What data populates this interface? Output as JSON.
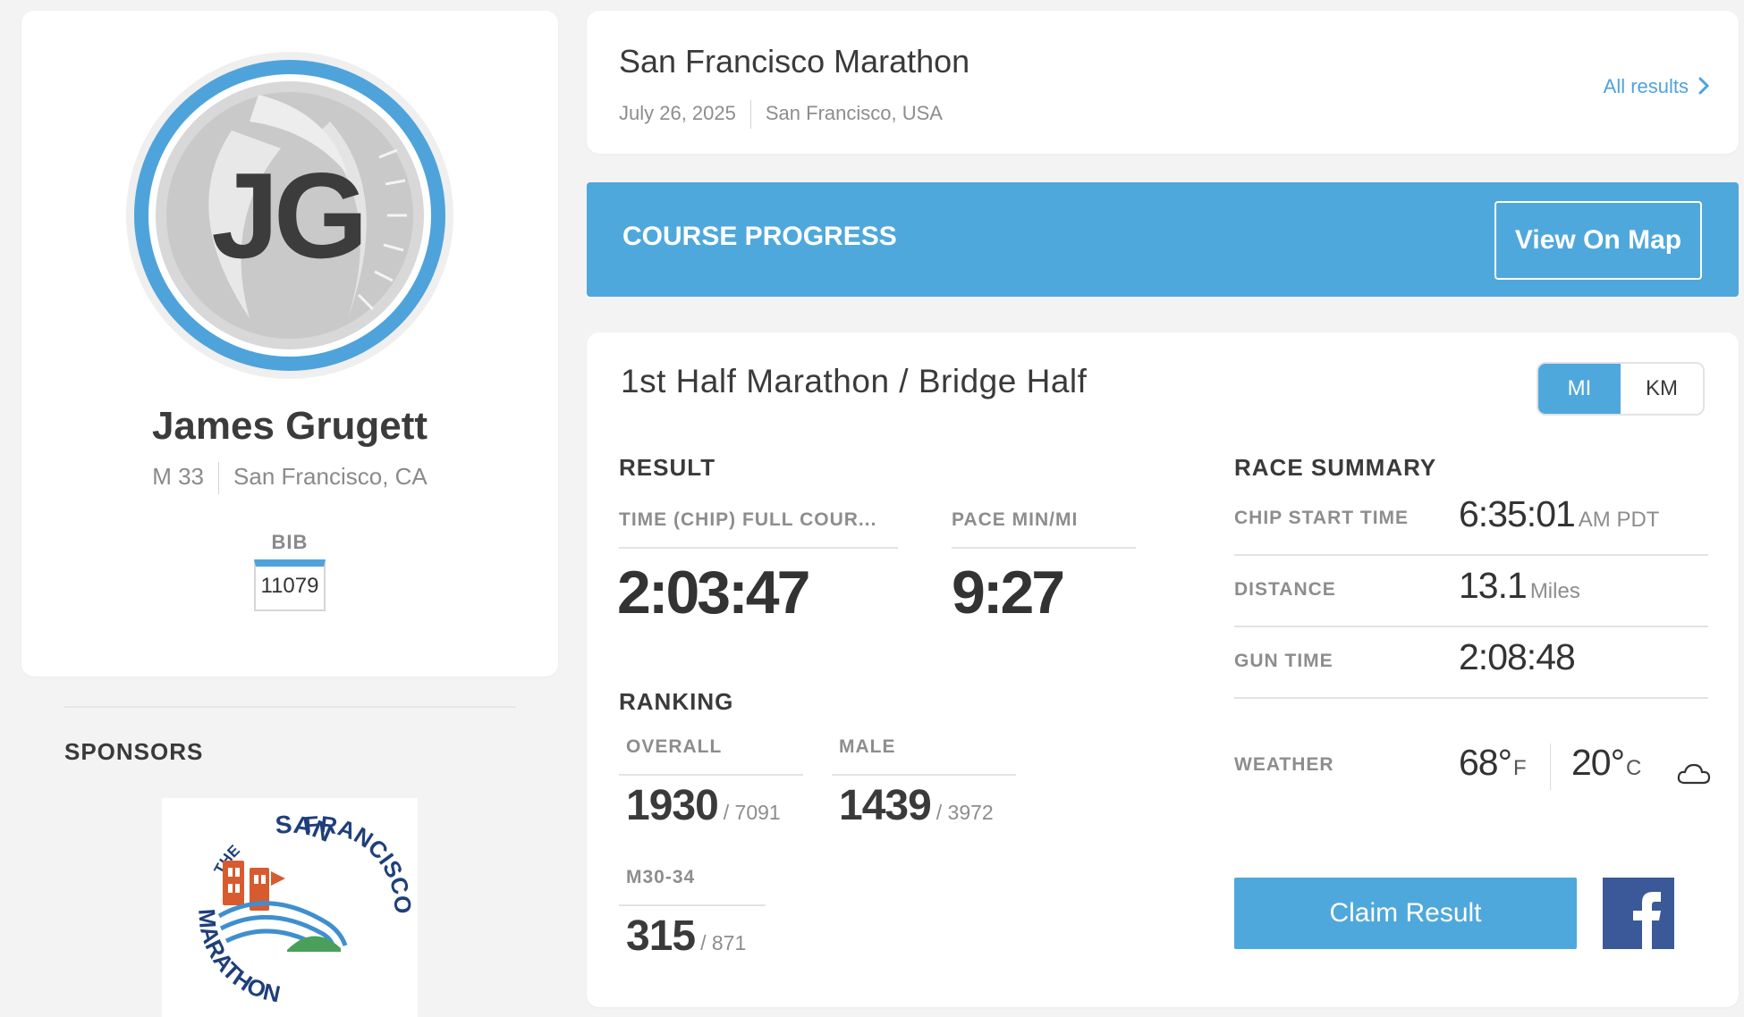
{
  "athlete": {
    "initials": "JG",
    "name": "James Grugett",
    "gender_age": "M 33",
    "location": "San Francisco, CA",
    "bib_label": "BIB",
    "bib_number": "11079"
  },
  "sponsors": {
    "title": "SPONSORS",
    "logo_text": {
      "the": "THE",
      "san": "SAN",
      "francisco": "FRANCISCO",
      "marathon": "MARATHON"
    }
  },
  "event": {
    "title": "San Francisco Marathon",
    "date": "July 26, 2025",
    "location": "San Francisco, USA",
    "all_results_label": "All results"
  },
  "course_progress": {
    "title": "COURSE PROGRESS",
    "view_map_label": "View On Map"
  },
  "race": {
    "name": "1st Half Marathon / Bridge Half",
    "units": [
      "MI",
      "KM"
    ],
    "selected_unit": "MI"
  },
  "result": {
    "title": "RESULT",
    "time_label": "TIME (CHIP) FULL COUR...",
    "time_value": "2:03:47",
    "pace_label": "PACE MIN/MI",
    "pace_value": "9:27"
  },
  "ranking": {
    "title": "RANKING",
    "overall": {
      "label": "OVERALL",
      "rank": "1930",
      "total": "/ 7091"
    },
    "gender": {
      "label": "MALE",
      "rank": "1439",
      "total": "/ 3972"
    },
    "age_group": {
      "label": "M30-34",
      "rank": "315",
      "total": "/ 871"
    }
  },
  "summary": {
    "title": "RACE SUMMARY",
    "chip_start": {
      "label": "CHIP START TIME",
      "value": "6:35:01",
      "unit": "AM PDT"
    },
    "distance": {
      "label": "DISTANCE",
      "value": "13.1",
      "unit": "Miles"
    },
    "gun_time": {
      "label": "GUN TIME",
      "value": "2:08:48"
    },
    "weather": {
      "label": "WEATHER",
      "temp_f": "68°",
      "unit_f": "F",
      "temp_c": "20°",
      "unit_c": "C",
      "icon": "cloud-icon"
    }
  },
  "actions": {
    "claim_label": "Claim Result",
    "facebook_icon": "facebook-icon"
  },
  "colors": {
    "accent": "#4fa8dc",
    "facebook": "#3b5998",
    "logo_orange": "#d85b30",
    "logo_navy": "#1f3f7a",
    "logo_green": "#4aa05a"
  }
}
